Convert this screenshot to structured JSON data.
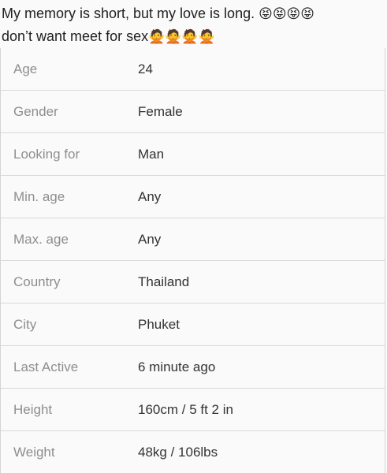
{
  "bio": {
    "line1": "My memory is short, but my love is long. ",
    "line1_emoji": "😝😝😝😝",
    "line2": "don’t want meet for sex",
    "line2_emoji": "🙅🙅🙅🙅"
  },
  "profile": {
    "rows": [
      {
        "label": "Age",
        "value": "24"
      },
      {
        "label": "Gender",
        "value": "Female"
      },
      {
        "label": "Looking for",
        "value": "Man"
      },
      {
        "label": "Min. age",
        "value": "Any"
      },
      {
        "label": "Max. age",
        "value": "Any"
      },
      {
        "label": "Country",
        "value": "Thailand"
      },
      {
        "label": "City",
        "value": "Phuket"
      },
      {
        "label": "Last Active",
        "value": "6 minute ago"
      },
      {
        "label": "Height",
        "value": "160cm / 5 ft 2 in"
      },
      {
        "label": "Weight",
        "value": "48kg / 106lbs"
      }
    ]
  }
}
